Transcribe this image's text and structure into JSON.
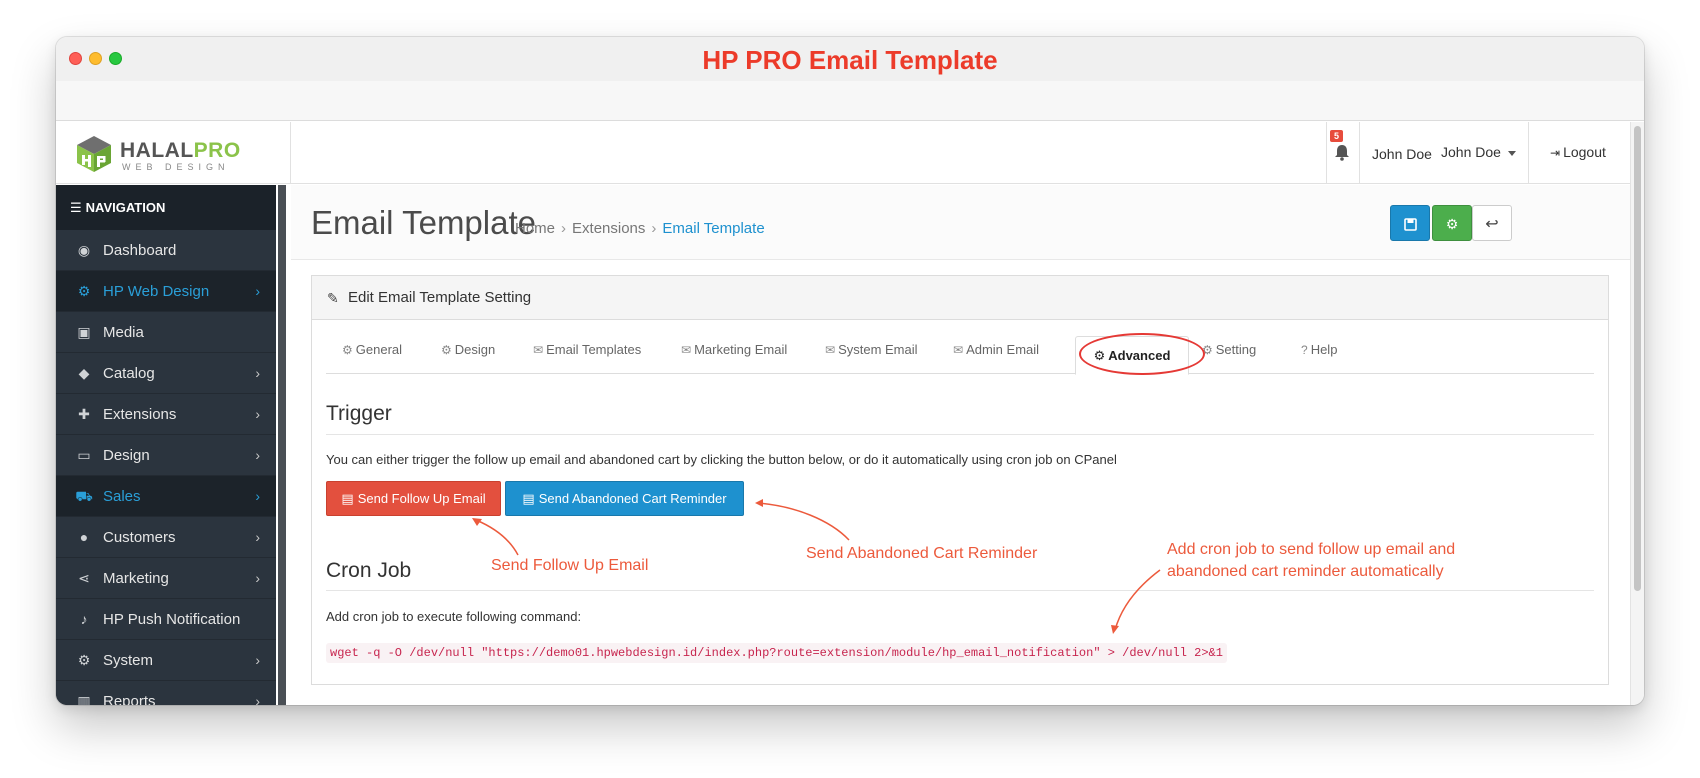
{
  "window": {
    "title": "HP PRO Email Template"
  },
  "logo": {
    "brand_part1": "HALAL",
    "brand_part2": "PRO",
    "tagline": "WEB DESIGN"
  },
  "header": {
    "notification_count": "5",
    "user_name": "John Doe",
    "user_menu_label": "John Doe",
    "logout_label": "Logout"
  },
  "sidebar": {
    "heading": "NAVIGATION",
    "items": [
      {
        "label": "Dashboard",
        "icon": "dashboard-icon",
        "has_children": false,
        "active": false
      },
      {
        "label": "HP Web Design",
        "icon": "gears-icon",
        "has_children": true,
        "active": true
      },
      {
        "label": "Media",
        "icon": "image-icon",
        "has_children": false,
        "active": false
      },
      {
        "label": "Catalog",
        "icon": "tags-icon",
        "has_children": true,
        "active": false
      },
      {
        "label": "Extensions",
        "icon": "puzzle-icon",
        "has_children": true,
        "active": false
      },
      {
        "label": "Design",
        "icon": "monitor-icon",
        "has_children": true,
        "active": false
      },
      {
        "label": "Sales",
        "icon": "cart-icon",
        "has_children": true,
        "active": true
      },
      {
        "label": "Customers",
        "icon": "user-icon",
        "has_children": true,
        "active": false
      },
      {
        "label": "Marketing",
        "icon": "share-icon",
        "has_children": true,
        "active": false
      },
      {
        "label": "HP Push Notification",
        "icon": "bell-icon",
        "has_children": false,
        "active": false
      },
      {
        "label": "System",
        "icon": "cog-icon",
        "has_children": true,
        "active": false
      },
      {
        "label": "Reports",
        "icon": "bar-chart-icon",
        "has_children": true,
        "active": false
      }
    ]
  },
  "page": {
    "title": "Email Template",
    "breadcrumb": [
      "Home",
      "Extensions",
      "Email Template"
    ]
  },
  "panel": {
    "heading": "Edit Email Template Setting",
    "tabs": [
      {
        "label": "General",
        "icon": "gears-icon"
      },
      {
        "label": "Design",
        "icon": "gears-icon"
      },
      {
        "label": "Email Templates",
        "icon": "envelope-icon"
      },
      {
        "label": "Marketing Email",
        "icon": "envelope-icon"
      },
      {
        "label": "System Email",
        "icon": "envelope-icon"
      },
      {
        "label": "Admin Email",
        "icon": "envelope-icon"
      },
      {
        "label": "Advanced",
        "icon": "gears-icon",
        "active": true
      },
      {
        "label": "Setting",
        "icon": "gears-icon"
      },
      {
        "label": "Help",
        "icon": "question-icon"
      }
    ],
    "trigger": {
      "title": "Trigger",
      "help": "You can either trigger the follow up email and abandoned cart by clicking the button below, or do it automatically using cron job on CPanel",
      "follow_up_button": "Send Follow Up Email",
      "abandoned_button": "Send Abandoned Cart Reminder"
    },
    "cron": {
      "title": "Cron Job",
      "help": "Add cron job to execute following command:",
      "command": "wget -q -O /dev/null \"https://demo01.hpwebdesign.id/index.php?route=extension/module/hp_email_notification\" > /dev/null 2>&1"
    }
  },
  "annotations": {
    "follow_up": "Send Follow Up Email",
    "abandoned": "Send Abandoned Cart Reminder",
    "cron_line1": "Add cron job to send follow up email and",
    "cron_line2": "abandoned cart reminder automatically"
  },
  "colors": {
    "accent_blue": "#1e91cf",
    "success_green": "#4cae4c",
    "danger_red": "#e3503e",
    "annotation_red": "#ec5a3c",
    "sidebar_bg": "#2b343e"
  }
}
